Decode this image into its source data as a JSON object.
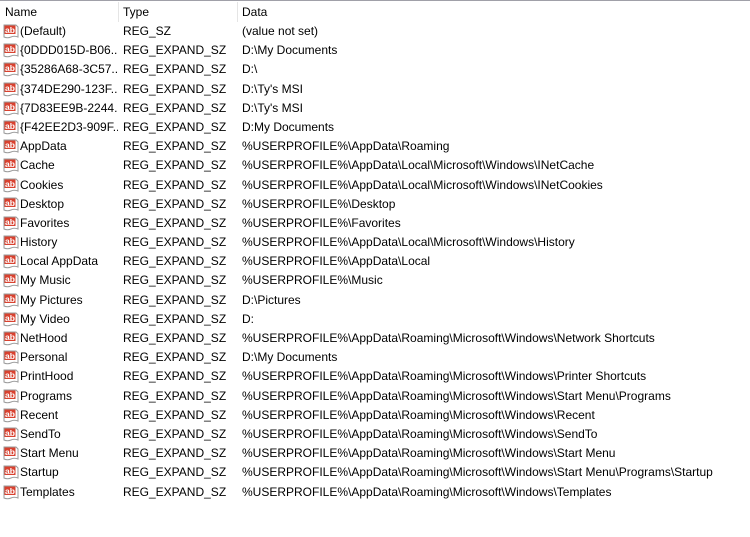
{
  "columns": {
    "name": "Name",
    "type": "Type",
    "data": "Data"
  },
  "colors": {
    "icon_red": "#d8412f",
    "header_divider": "#e5e5e5",
    "top_border": "#a0a0a8"
  },
  "rows": [
    {
      "icon": "string-value-icon",
      "name": "(Default)",
      "type": "REG_SZ",
      "data": "(value not set)"
    },
    {
      "icon": "string-value-icon",
      "name": "{0DDD015D-B06...",
      "type": "REG_EXPAND_SZ",
      "data": "D:\\My Documents"
    },
    {
      "icon": "string-value-icon",
      "name": "{35286A68-3C57...",
      "type": "REG_EXPAND_SZ",
      "data": "D:\\"
    },
    {
      "icon": "string-value-icon",
      "name": "{374DE290-123F...",
      "type": "REG_EXPAND_SZ",
      "data": "D:\\Ty's MSI"
    },
    {
      "icon": "string-value-icon",
      "name": "{7D83EE9B-2244...",
      "type": "REG_EXPAND_SZ",
      "data": "D:\\Ty's MSI"
    },
    {
      "icon": "string-value-icon",
      "name": "{F42EE2D3-909F...",
      "type": "REG_EXPAND_SZ",
      "data": "D:My Documents"
    },
    {
      "icon": "string-value-icon",
      "name": "AppData",
      "type": "REG_EXPAND_SZ",
      "data": "%USERPROFILE%\\AppData\\Roaming"
    },
    {
      "icon": "string-value-icon",
      "name": "Cache",
      "type": "REG_EXPAND_SZ",
      "data": "%USERPROFILE%\\AppData\\Local\\Microsoft\\Windows\\INetCache"
    },
    {
      "icon": "string-value-icon",
      "name": "Cookies",
      "type": "REG_EXPAND_SZ",
      "data": "%USERPROFILE%\\AppData\\Local\\Microsoft\\Windows\\INetCookies"
    },
    {
      "icon": "string-value-icon",
      "name": "Desktop",
      "type": "REG_EXPAND_SZ",
      "data": "%USERPROFILE%\\Desktop"
    },
    {
      "icon": "string-value-icon",
      "name": "Favorites",
      "type": "REG_EXPAND_SZ",
      "data": "%USERPROFILE%\\Favorites"
    },
    {
      "icon": "string-value-icon",
      "name": "History",
      "type": "REG_EXPAND_SZ",
      "data": "%USERPROFILE%\\AppData\\Local\\Microsoft\\Windows\\History"
    },
    {
      "icon": "string-value-icon",
      "name": "Local AppData",
      "type": "REG_EXPAND_SZ",
      "data": "%USERPROFILE%\\AppData\\Local"
    },
    {
      "icon": "string-value-icon",
      "name": "My Music",
      "type": "REG_EXPAND_SZ",
      "data": "%USERPROFILE%\\Music"
    },
    {
      "icon": "string-value-icon",
      "name": "My Pictures",
      "type": "REG_EXPAND_SZ",
      "data": "D:\\Pictures"
    },
    {
      "icon": "string-value-icon",
      "name": "My Video",
      "type": "REG_EXPAND_SZ",
      "data": "D:"
    },
    {
      "icon": "string-value-icon",
      "name": "NetHood",
      "type": "REG_EXPAND_SZ",
      "data": "%USERPROFILE%\\AppData\\Roaming\\Microsoft\\Windows\\Network Shortcuts"
    },
    {
      "icon": "string-value-icon",
      "name": "Personal",
      "type": "REG_EXPAND_SZ",
      "data": "D:\\My Documents"
    },
    {
      "icon": "string-value-icon",
      "name": "PrintHood",
      "type": "REG_EXPAND_SZ",
      "data": "%USERPROFILE%\\AppData\\Roaming\\Microsoft\\Windows\\Printer Shortcuts"
    },
    {
      "icon": "string-value-icon",
      "name": "Programs",
      "type": "REG_EXPAND_SZ",
      "data": "%USERPROFILE%\\AppData\\Roaming\\Microsoft\\Windows\\Start Menu\\Programs"
    },
    {
      "icon": "string-value-icon",
      "name": "Recent",
      "type": "REG_EXPAND_SZ",
      "data": "%USERPROFILE%\\AppData\\Roaming\\Microsoft\\Windows\\Recent"
    },
    {
      "icon": "string-value-icon",
      "name": "SendTo",
      "type": "REG_EXPAND_SZ",
      "data": "%USERPROFILE%\\AppData\\Roaming\\Microsoft\\Windows\\SendTo"
    },
    {
      "icon": "string-value-icon",
      "name": "Start Menu",
      "type": "REG_EXPAND_SZ",
      "data": "%USERPROFILE%\\AppData\\Roaming\\Microsoft\\Windows\\Start Menu"
    },
    {
      "icon": "string-value-icon",
      "name": "Startup",
      "type": "REG_EXPAND_SZ",
      "data": "%USERPROFILE%\\AppData\\Roaming\\Microsoft\\Windows\\Start Menu\\Programs\\Startup"
    },
    {
      "icon": "string-value-icon",
      "name": "Templates",
      "type": "REG_EXPAND_SZ",
      "data": "%USERPROFILE%\\AppData\\Roaming\\Microsoft\\Windows\\Templates"
    }
  ]
}
